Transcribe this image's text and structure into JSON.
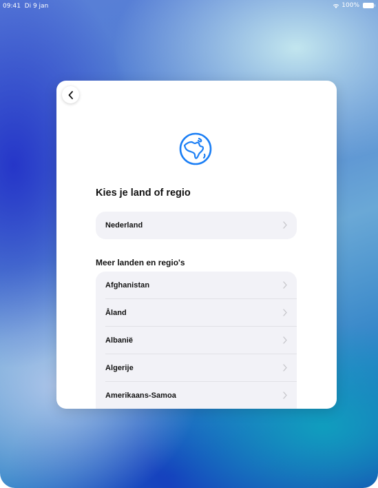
{
  "status_bar": {
    "time": "09:41",
    "date": "Di 9 jan",
    "battery": "100%"
  },
  "colors": {
    "accent": "#1a7ef5",
    "sheet": "#ffffff",
    "row_bg": "#f2f2f7"
  },
  "icons": {
    "back": "chevron-left-icon",
    "globe": "globe-icon",
    "row": "chevron-right-icon"
  },
  "setup": {
    "title": "Kies je land of regio",
    "current_region": "Nederland",
    "section_title": "Meer landen en regio's",
    "regions": [
      {
        "label": "Afghanistan"
      },
      {
        "label": "Åland"
      },
      {
        "label": "Albanië"
      },
      {
        "label": "Algerije"
      },
      {
        "label": "Amerikaans-Samoa"
      }
    ]
  }
}
